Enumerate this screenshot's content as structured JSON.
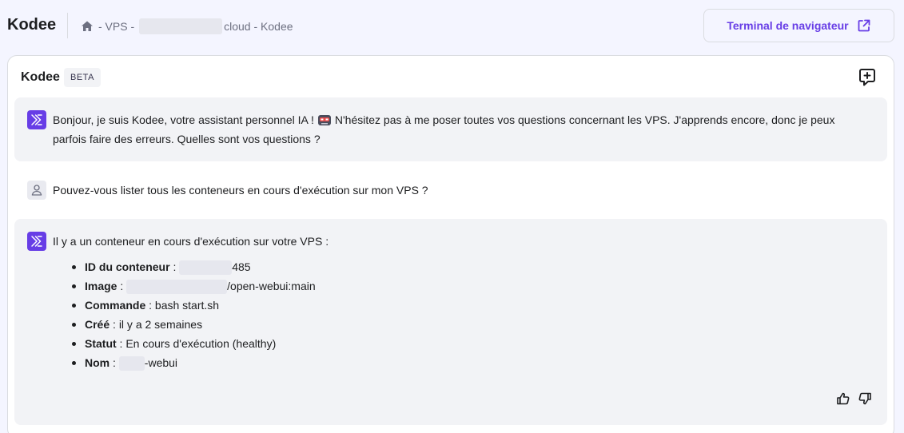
{
  "header": {
    "title": "Kodee",
    "breadcrumb": {
      "sep1": "- VPS -",
      "host_suffix": "cloud - Kodee"
    },
    "terminal_button": "Terminal de navigateur"
  },
  "chat": {
    "title": "Kodee",
    "badge": "BETA",
    "messages": [
      {
        "role": "assistant",
        "line1_a": "Bonjour, je suis Kodee, votre assistant personnel IA !",
        "line1_b": "N'hésitez pas à me poser toutes vos questions concernant les VPS. J'apprends encore, donc je peux",
        "line2": "parfois faire des erreurs. Quelles sont vos questions ?"
      },
      {
        "role": "user",
        "text": "Pouvez-vous lister tous les conteneurs en cours d'exécution sur mon VPS ?"
      },
      {
        "role": "assistant",
        "intro": "Il y a un conteneur en cours d'exécution sur votre VPS :",
        "items": [
          {
            "label": "ID du conteneur",
            "sep": " : ",
            "value": "485"
          },
          {
            "label": "Image",
            "sep": " : ",
            "value": "/open-webui:main"
          },
          {
            "label": "Commande",
            "sep": " : ",
            "value": "bash start.sh"
          },
          {
            "label": "Créé",
            "sep": " : ",
            "value": "il y a 2 semaines"
          },
          {
            "label": "Statut",
            "sep": " : ",
            "value": "En cours d'exécution (healthy)"
          },
          {
            "label": "Nom",
            "sep": " : ",
            "value": "-webui"
          }
        ]
      }
    ]
  },
  "icons": {
    "home": "home-icon",
    "external": "external-link-icon",
    "new_chat": "chat-plus-icon",
    "kodee": "kodee-logo-icon",
    "user": "user-icon",
    "thumbs_up": "thumbs-up-icon",
    "thumbs_down": "thumbs-down-icon"
  },
  "colors": {
    "accent": "#673de6",
    "background": "#f4f5ff",
    "bubble": "#f2f3f6"
  }
}
